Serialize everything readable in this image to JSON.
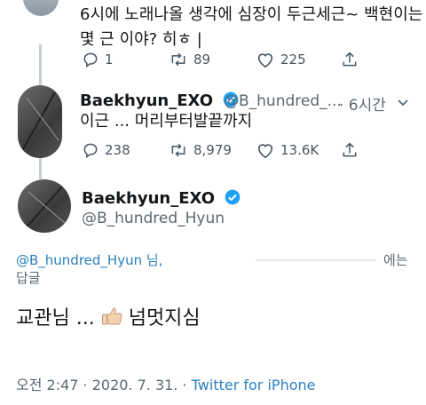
{
  "tweet1": {
    "text_line1": "6시에 노래나올 생각에 심장이 두근세근~ 백현이는",
    "text_line2": "몇 근 이야? 히ㅎ |",
    "replies": "1",
    "retweets": "89",
    "likes": "225"
  },
  "tweet2": {
    "name": "Baekhyun_EXO",
    "handle": "@B_hundred_...",
    "time": "· 6시간",
    "text": "이근 ... 머리부터발끝까지",
    "replies": "238",
    "retweets": "8,979",
    "likes": "13.6K"
  },
  "main_tweet": {
    "name": "Baekhyun_EXO",
    "handle": "@B_hundred_Hyun",
    "reply_to": "@B_hundred_Hyun 님,",
    "reply_suffix": "에는",
    "reply_label": "답글",
    "text_before": "교관님 ...",
    "text_after": "넘멋지심",
    "timestamp": "오전 2:47 · 2020. 7. 31. · ",
    "source": "Twitter for iPhone"
  },
  "colors": {
    "link": "#2a7fbf",
    "verified": "#1da1f2",
    "thread": "#c4cfd6"
  },
  "icons": [
    "reply-icon",
    "retweet-icon",
    "like-icon",
    "share-icon",
    "verified-icon",
    "chevron-down-icon",
    "thumbs-up-emoji"
  ]
}
